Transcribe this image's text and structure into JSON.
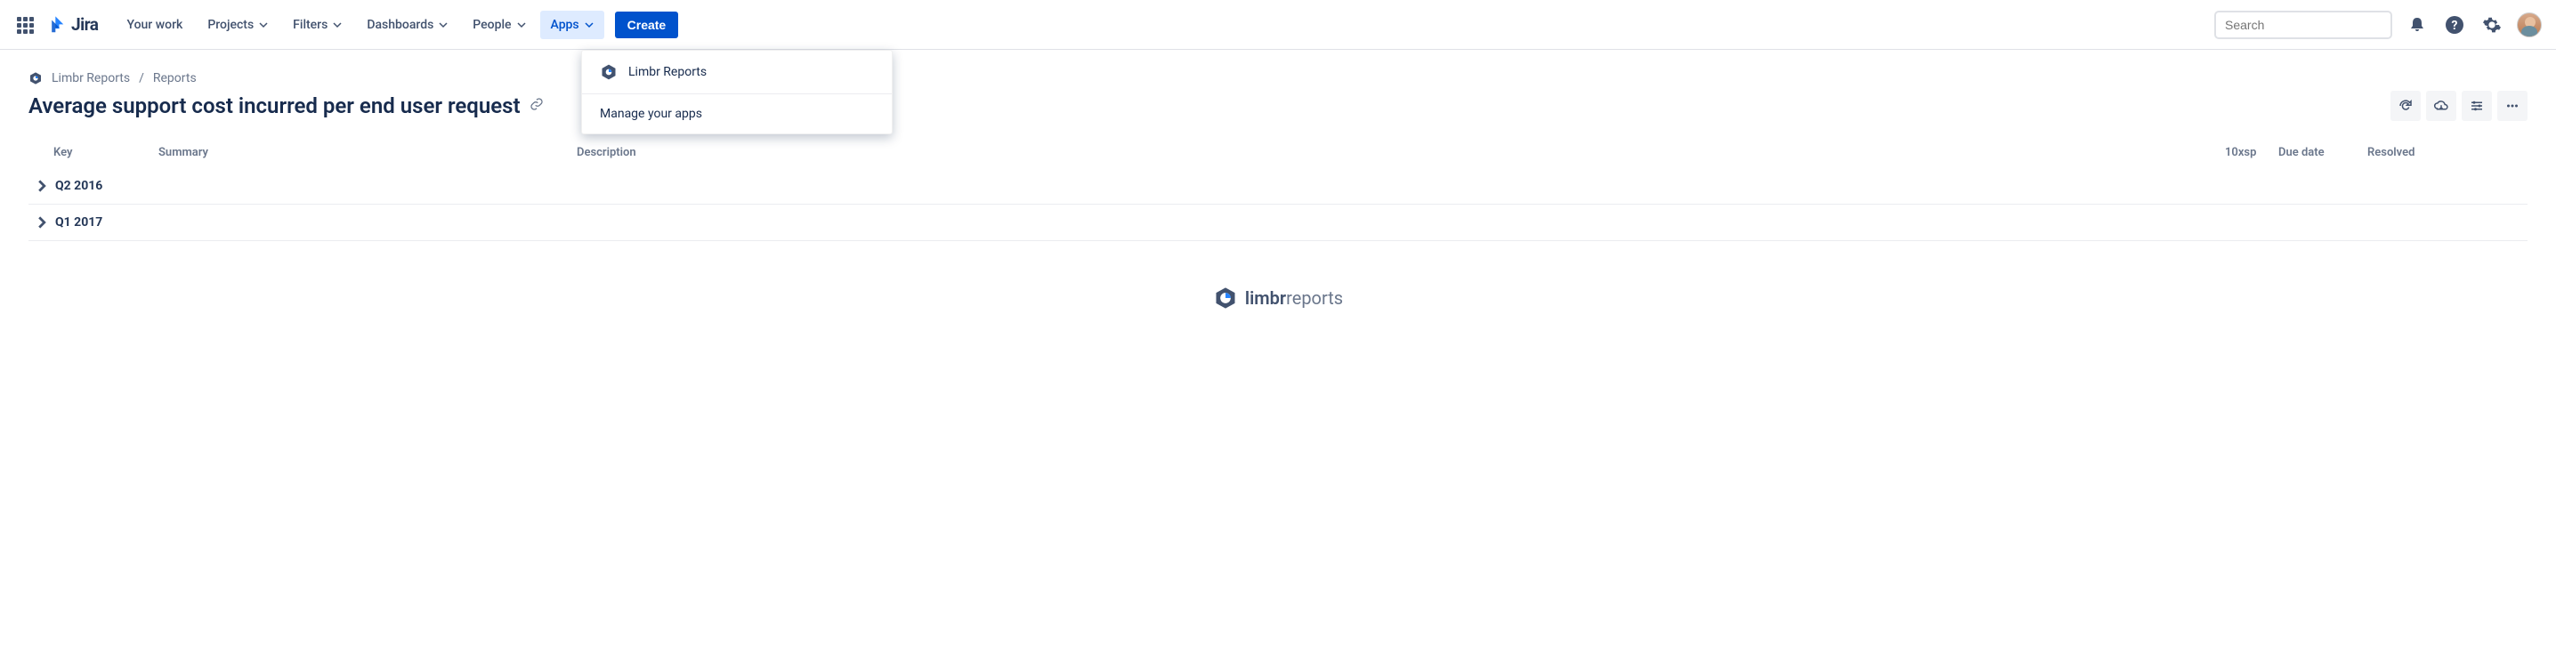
{
  "nav": {
    "product": "Jira",
    "your_work": "Your work",
    "projects": "Projects",
    "filters": "Filters",
    "dashboards": "Dashboards",
    "people": "People",
    "apps": "Apps",
    "create": "Create",
    "search_placeholder": "Search"
  },
  "apps_dropdown": {
    "limbr_reports": "Limbr Reports",
    "manage": "Manage your apps"
  },
  "breadcrumb": {
    "project": "Limbr Reports",
    "section": "Reports"
  },
  "page_title": "Average support cost incurred per end user request",
  "columns": {
    "key": "Key",
    "summary": "Summary",
    "description": "Description",
    "tenxsp": "10xsp",
    "due_date": "Due date",
    "resolved": "Resolved"
  },
  "groups": [
    {
      "label": "Q2 2016"
    },
    {
      "label": "Q1 2017"
    }
  ],
  "footer": {
    "brand_strong": "limbr",
    "brand_light": "reports"
  }
}
